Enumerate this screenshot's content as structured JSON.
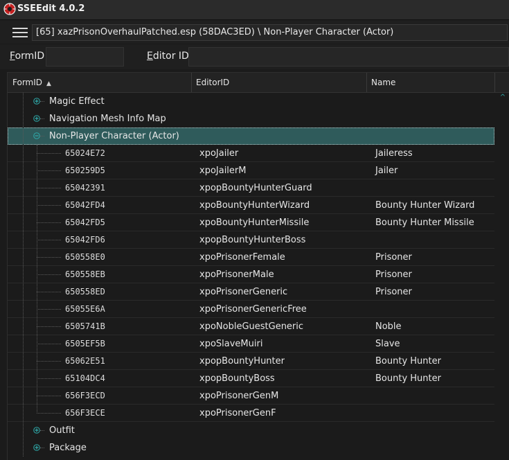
{
  "app": {
    "title": "SSEEdit 4.0.2"
  },
  "path": {
    "text": "[65] xazPrisonOverhaulPatched.esp (58DAC3ED) \\ Non-Player Character (Actor)"
  },
  "filter": {
    "formid_label_mnemonic": "F",
    "formid_label_rest": "ormID",
    "formid_value": "",
    "editorid_label_mnemonic": "E",
    "editorid_label_rest": "ditor ID",
    "editorid_value": ""
  },
  "columns": {
    "formid": "FormID",
    "editorid": "EditorID",
    "name": "Name"
  },
  "tree": {
    "groups_before": [
      {
        "label": "Magic Effect",
        "expanded": false
      },
      {
        "label": "Navigation Mesh Info Map",
        "expanded": false
      }
    ],
    "selected_group": {
      "label": "Non-Player Character (Actor)",
      "expanded": true
    },
    "records": [
      {
        "formid": "65024E72",
        "editorid": "xpoJailer",
        "name": "Jaileress"
      },
      {
        "formid": "650259D5",
        "editorid": "xpoJailerM",
        "name": "Jailer"
      },
      {
        "formid": "65042391",
        "editorid": "xpopBountyHunterGuard",
        "name": ""
      },
      {
        "formid": "65042FD4",
        "editorid": "xpoBountyHunterWizard",
        "name": "Bounty Hunter Wizard"
      },
      {
        "formid": "65042FD5",
        "editorid": "xpoBountyHunterMissile",
        "name": "Bounty Hunter Missile"
      },
      {
        "formid": "65042FD6",
        "editorid": "xpopBountyHunterBoss",
        "name": ""
      },
      {
        "formid": "650558E0",
        "editorid": "xpoPrisonerFemale",
        "name": "Prisoner"
      },
      {
        "formid": "650558EB",
        "editorid": "xpoPrisonerMale",
        "name": "Prisoner"
      },
      {
        "formid": "650558ED",
        "editorid": "xpoPrisonerGeneric",
        "name": "Prisoner"
      },
      {
        "formid": "65055E6A",
        "editorid": "xpoPrisonerGenericFree",
        "name": ""
      },
      {
        "formid": "6505741B",
        "editorid": "xpoNobleGuestGeneric",
        "name": "Noble"
      },
      {
        "formid": "6505EF5B",
        "editorid": "xpoSlaveMuiri",
        "name": "Slave"
      },
      {
        "formid": "65062E51",
        "editorid": "xpopBountyHunter",
        "name": "Bounty Hunter"
      },
      {
        "formid": "65104DC4",
        "editorid": "xpopBountyBoss",
        "name": "Bounty Hunter"
      },
      {
        "formid": "656F3ECD",
        "editorid": "xpoPrisonerGenM",
        "name": ""
      },
      {
        "formid": "656F3ECE",
        "editorid": "xpoPrisonerGenF",
        "name": ""
      }
    ],
    "groups_after": [
      {
        "label": "Outfit",
        "expanded": false
      },
      {
        "label": "Package",
        "expanded": false
      }
    ]
  },
  "colors": {
    "accent": "#2fa8a8",
    "selection": "#2f5b5b",
    "background": "#1b1b1b"
  }
}
